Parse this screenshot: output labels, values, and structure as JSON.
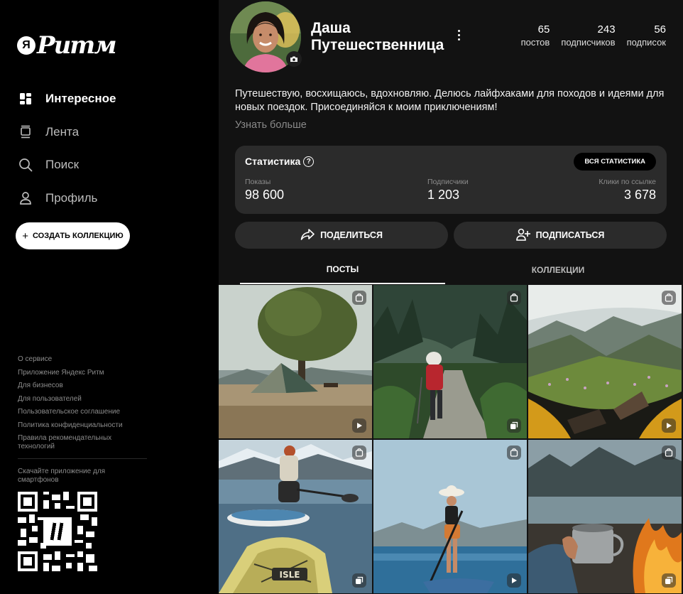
{
  "brand": {
    "logo_ya": "Я",
    "logo_word": "Ритм"
  },
  "nav": [
    {
      "label": "Интересное",
      "icon": "grid-icon",
      "active": true
    },
    {
      "label": "Лента",
      "icon": "feed-icon",
      "active": false
    },
    {
      "label": "Поиск",
      "icon": "search-icon",
      "active": false
    },
    {
      "label": "Профиль",
      "icon": "profile-icon",
      "active": false
    }
  ],
  "create_button": {
    "label": "СОЗДАТЬ КОЛЛЕКЦИЮ",
    "icon": "plus-icon"
  },
  "footer_links": [
    "О сервисе",
    "Приложение Яндекс Ритм",
    "Для бизнесов",
    "Для пользователей",
    "Пользовательское соглашение",
    "Политика конфиденциальности",
    "Правила рекомендательных технологий"
  ],
  "download_text": "Скачайте приложение для смартфонов",
  "profile": {
    "name": "Даша Путешественница",
    "stats": [
      {
        "value": "65",
        "label": "постов"
      },
      {
        "value": "243",
        "label": "подписчиков"
      },
      {
        "value": "56",
        "label": "подписок"
      }
    ],
    "bio": "Путешествую, восхищаюсь, вдохновляю. Делюсь лайфхаками для походов и идеями для новых поездок. Присоединяйся к моим приключениям!",
    "more_label": "Узнать больше"
  },
  "statistics": {
    "title": "Статистика",
    "help_glyph": "?",
    "all_button": "ВСЯ СТАТИСТИКА",
    "metrics": [
      {
        "label": "Показы",
        "value": "98 600"
      },
      {
        "label": "Подписчики",
        "value": "1 203"
      },
      {
        "label": "Клики по ссылке",
        "value": "3 678"
      }
    ]
  },
  "actions": {
    "share": "ПОДЕЛИТЬСЯ",
    "subscribe": "ПОДПИСАТЬСЯ"
  },
  "tabs": {
    "posts": "ПОСТЫ",
    "collections": "КОЛЛЕКЦИИ",
    "active": "posts"
  },
  "tiles": [
    {
      "scene": "tent-camp",
      "corner_badge": "shopping-bag-icon",
      "bottom_badge": "play-icon"
    },
    {
      "scene": "hiker-forest",
      "corner_badge": "shopping-bag-icon",
      "bottom_badge": "gallery-icon"
    },
    {
      "scene": "mountain-tent-view",
      "corner_badge": "shopping-bag-icon",
      "bottom_badge": "play-icon"
    },
    {
      "scene": "paddleboard-lake",
      "corner_badge": "shopping-bag-icon",
      "bottom_badge": "gallery-icon"
    },
    {
      "scene": "sup-woman",
      "corner_badge": "shopping-bag-icon",
      "bottom_badge": "play-icon"
    },
    {
      "scene": "campfire-mug",
      "corner_badge": "shopping-bag-icon",
      "bottom_badge": "gallery-icon"
    }
  ],
  "paddleboard_text": "ISLE"
}
